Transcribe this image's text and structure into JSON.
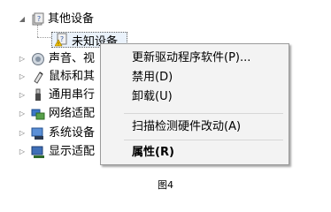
{
  "tree": {
    "parent": {
      "label": "其他设备",
      "icon": "unknown-device-category-icon"
    },
    "selected": {
      "label": "未知设备",
      "icon": "unknown-device-warning-icon"
    },
    "items": [
      {
        "label": "声音、视",
        "icon": "speaker-icon"
      },
      {
        "label": "鼠标和其",
        "icon": "mouse-icon"
      },
      {
        "label": "通用串行",
        "icon": "usb-plug-icon"
      },
      {
        "label": "网络适配",
        "icon": "network-adapter-icon"
      },
      {
        "label": "系统设备",
        "icon": "system-device-icon"
      },
      {
        "label": "显示适配",
        "icon": "display-adapter-icon"
      }
    ]
  },
  "context_menu": {
    "update_driver": "更新驱动程序软件(P)...",
    "disable": "禁用(D)",
    "uninstall": "卸载(U)",
    "scan_hardware": "扫描检测硬件改动(A)",
    "properties": "属性(R)"
  },
  "caption": "图4"
}
